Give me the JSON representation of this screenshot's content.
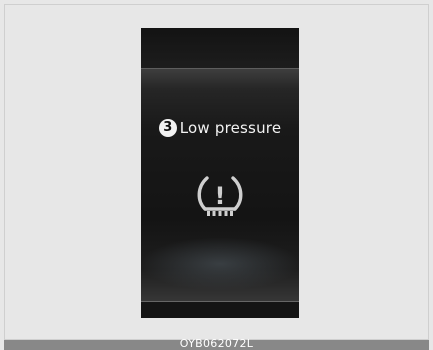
{
  "display": {
    "message_number": "3",
    "message_text": "Low pressure",
    "warning_icon": "tpms-low-tire-pressure-icon",
    "warning_glyph": "!"
  },
  "caption": {
    "code": "OYB062072L"
  },
  "colors": {
    "page_background": "#e7e7e7",
    "display_background": "#1a1a1a",
    "icon_color": "#cfcfcf",
    "text_color": "#f2f2f2"
  }
}
